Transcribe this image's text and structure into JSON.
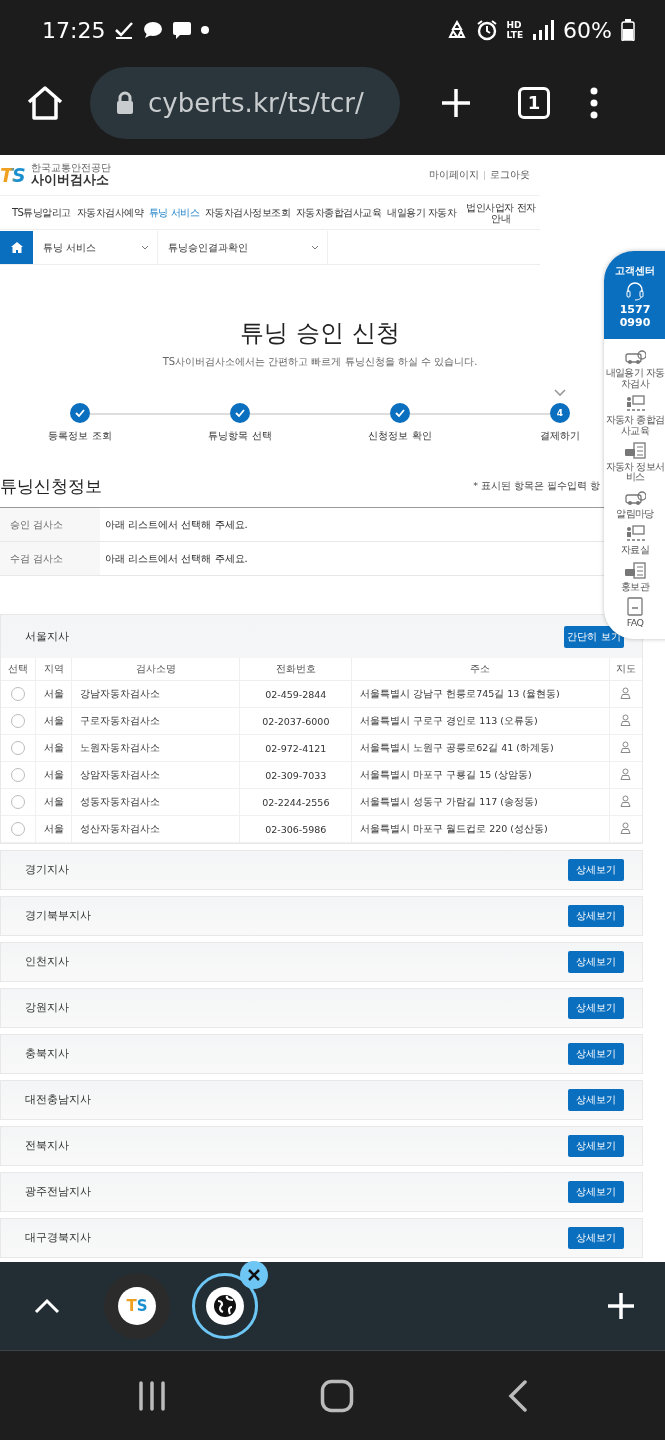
{
  "status_bar": {
    "time": "17:25",
    "voice": "HD",
    "network": "LTE",
    "battery": "60%"
  },
  "browser": {
    "url": "cyberts.kr/ts/tcr/",
    "tab_count": "1"
  },
  "site": {
    "logo": "TS",
    "org": "한국교통안전공단",
    "name": "사이버검사소",
    "links": [
      "마이페이지",
      "로그아웃"
    ]
  },
  "menu": [
    {
      "label": "TS튜닝알리고",
      "selected": false
    },
    {
      "label": "자동차검사예약",
      "selected": false
    },
    {
      "label": "튜닝 서비스",
      "selected": true
    },
    {
      "label": "자동차검사정보조회",
      "selected": false
    },
    {
      "label": "자동차종합검사교육",
      "selected": false
    },
    {
      "label": "내일용기 자동차",
      "selected": false
    },
    {
      "label": "법인사업자 전자안내",
      "selected": false
    }
  ],
  "breadcrumb": [
    "튜닝 서비스",
    "튜닝승인결과확인"
  ],
  "heading": {
    "title": "튜닝 승인 신청",
    "subtitle": "TS사이버검사소에서는 간편하고 빠르게 튜닝신청을 하실 수 있습니다."
  },
  "steps": [
    {
      "label": "등록정보 조회",
      "done": true,
      "current": false
    },
    {
      "label": "튜닝항목 선택",
      "done": true,
      "current": false
    },
    {
      "label": "신청정보 확인",
      "done": true,
      "current": false
    },
    {
      "label": "결제하기",
      "done": false,
      "current": true,
      "number": "4"
    }
  ],
  "section": {
    "title": "튜닝신청정보",
    "note": "* 표시된 항목은 필수입력 항"
  },
  "info_rows": [
    {
      "label": "승인 검사소",
      "value": "아래 리스트에서 선택해 주세요."
    },
    {
      "label": "수검 검사소",
      "value": "아래 리스트에서 선택해 주세요."
    }
  ],
  "branches": [
    {
      "name": "서울지사",
      "expanded": true,
      "button": "간단히 보기",
      "table": {
        "columns": [
          "선택",
          "지역",
          "검사소명",
          "전화번호",
          "주소",
          "지도"
        ],
        "rows": [
          {
            "selected": false,
            "region": "서울",
            "name": "강남자동차검사소",
            "phone": "02-459-2844",
            "address": "서울특별시 강남구 헌릉로745길 13 (율현동)"
          },
          {
            "selected": false,
            "region": "서울",
            "name": "구로자동차검사소",
            "phone": "02-2037-6000",
            "address": "서울특별시 구로구 경인로 113 (오류동)"
          },
          {
            "selected": false,
            "region": "서울",
            "name": "노원자동차검사소",
            "phone": "02-972-4121",
            "address": "서울특별시 노원구 공릉로62길 41 (하계동)"
          },
          {
            "selected": false,
            "region": "서울",
            "name": "상암자동차검사소",
            "phone": "02-309-7033",
            "address": "서울특별시 마포구 구룡길 15 (상암동)"
          },
          {
            "selected": false,
            "region": "서울",
            "name": "성동자동차검사소",
            "phone": "02-2244-2556",
            "address": "서울특별시 성동구 가람길 117 (송정동)"
          },
          {
            "selected": false,
            "region": "서울",
            "name": "성산자동차검사소",
            "phone": "02-306-5986",
            "address": "서울특별시 마포구 월드컵로 220 (성산동)"
          }
        ]
      }
    },
    {
      "name": "경기지사",
      "expanded": false,
      "button": "상세보기"
    },
    {
      "name": "경기북부지사",
      "expanded": false,
      "button": "상세보기"
    },
    {
      "name": "인천지사",
      "expanded": false,
      "button": "상세보기"
    },
    {
      "name": "강원지사",
      "expanded": false,
      "button": "상세보기"
    },
    {
      "name": "충북지사",
      "expanded": false,
      "button": "상세보기"
    },
    {
      "name": "대전충남지사",
      "expanded": false,
      "button": "상세보기"
    },
    {
      "name": "전북지사",
      "expanded": false,
      "button": "상세보기"
    },
    {
      "name": "광주전남지사",
      "expanded": false,
      "button": "상세보기"
    },
    {
      "name": "대구경북지사",
      "expanded": false,
      "button": "상세보기"
    }
  ],
  "quick_menu": {
    "title": "고객센터",
    "phone": "1577 0990",
    "items": [
      {
        "kind": "car",
        "label": "내일용기 자동차검사"
      },
      {
        "kind": "board",
        "label": "자동차 종합검사교육"
      },
      {
        "kind": "checklist",
        "label": "자동차 정보서비스"
      },
      {
        "kind": "car",
        "label": "알림마당"
      },
      {
        "kind": "board",
        "label": "자료실"
      },
      {
        "kind": "checklist",
        "label": "홍보관"
      },
      {
        "kind": "document",
        "label": "FAQ"
      }
    ]
  },
  "tabs": [
    {
      "kind": "site",
      "label": "TS",
      "selected": false
    },
    {
      "kind": "globe",
      "selected": true
    }
  ]
}
